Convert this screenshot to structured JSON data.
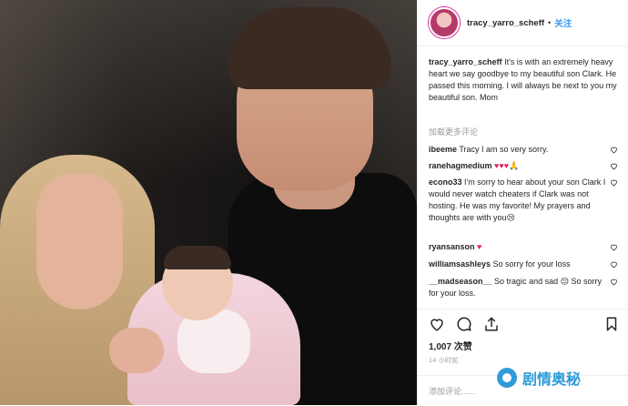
{
  "post": {
    "username": "tracy_yarro_scheff",
    "separator": "•",
    "follow_label": "关注",
    "caption_user": "tracy_yarro_scheff",
    "caption_text": " It's is with an extremely heavy heart we say goodbye to my beautiful son Clark. He passed this morning. I will always be next to you my beautiful son. Mom",
    "load_more_label": "加载更多评论",
    "likes": "1,007 次赞",
    "timestamp": "14 小时前",
    "add_comment_placeholder": "添加评论......"
  },
  "comments": [
    {
      "user": "ibeeme",
      "text": " Tracy I am so very sorry."
    },
    {
      "user": "ranehagmedium",
      "text": " ♥♥♥🙏"
    },
    {
      "user": "econo33",
      "text": " I'm sorry to hear about your son Clark I would never watch cheaters if Clark was not hosting. He was my favorite! My prayers and thoughts are with you😢"
    },
    {
      "user": "ryansanson",
      "text": " ♥"
    },
    {
      "user": "williamsashleys",
      "text": " So sorry for your loss"
    },
    {
      "user": "__madseason__",
      "text": " So tragic and sad 😔 So sorry for your loss."
    }
  ],
  "watermark": {
    "text": "剧情奥秘"
  },
  "icons": [
    "heart-icon",
    "comment-icon",
    "share-icon",
    "bookmark-icon"
  ],
  "colors": {
    "accent": "#3897f0",
    "heart_red": "#e0245e",
    "watermark": "#2f9bd8"
  }
}
